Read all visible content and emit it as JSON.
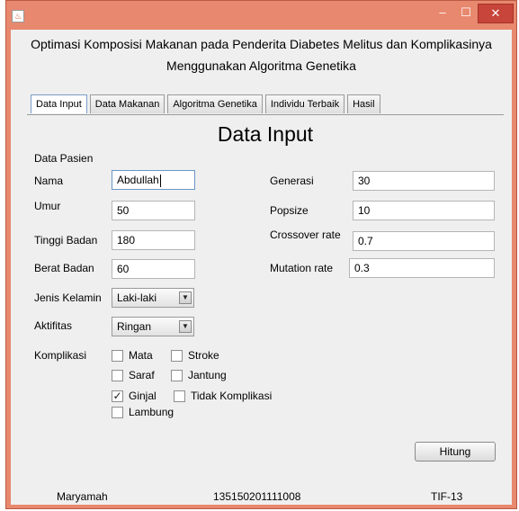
{
  "window": {
    "app_icon": "java-icon",
    "controls": {
      "minimize": "–",
      "maximize": "☐",
      "close": "✕"
    }
  },
  "header": {
    "line1": "Optimasi Komposisi Makanan pada Penderita Diabetes Melitus dan Komplikasinya",
    "line2": "Menggunakan Algoritma Genetika"
  },
  "tabs": [
    {
      "label": "Data Input",
      "active": true
    },
    {
      "label": "Data Makanan"
    },
    {
      "label": "Algoritma Genetika"
    },
    {
      "label": "Individu Terbaik"
    },
    {
      "label": "Hasil"
    }
  ],
  "panel": {
    "title": "Data Input",
    "section_label": "Data Pasien"
  },
  "patient": {
    "nama": {
      "label": "Nama",
      "value": "Abdullah"
    },
    "umur": {
      "label": "Umur",
      "value": "50"
    },
    "tinggi": {
      "label": "Tinggi Badan",
      "value": "180"
    },
    "berat": {
      "label": "Berat Badan",
      "value": "60"
    },
    "kelamin": {
      "label": "Jenis Kelamin",
      "value": "Laki-laki"
    },
    "aktifitas": {
      "label": "Aktifitas",
      "value": "Ringan"
    }
  },
  "ga": {
    "generasi": {
      "label": "Generasi",
      "value": "30"
    },
    "popsize": {
      "label": "Popsize",
      "value": "10"
    },
    "crossover": {
      "label": "Crossover rate",
      "value": "0.7"
    },
    "mutation": {
      "label": "Mutation rate",
      "value": "0.3"
    }
  },
  "komplikasi": {
    "label": "Komplikasi",
    "items": [
      {
        "label": "Mata",
        "checked": false
      },
      {
        "label": "Stroke",
        "checked": false
      },
      {
        "label": "Saraf",
        "checked": false
      },
      {
        "label": "Jantung",
        "checked": false
      },
      {
        "label": "Ginjal",
        "checked": true,
        "mark": "✓"
      },
      {
        "label": "Tidak Komplikasi",
        "checked": false
      },
      {
        "label": "Lambung",
        "checked": false
      }
    ]
  },
  "actions": {
    "hitung": "Hitung"
  },
  "footer": {
    "name": "Maryamah",
    "nim": "135150201111008",
    "class": "TIF-13"
  }
}
